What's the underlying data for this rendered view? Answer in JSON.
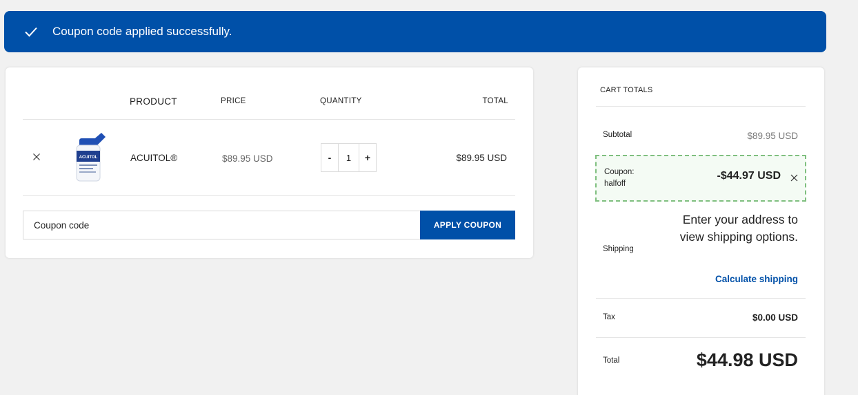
{
  "notice": {
    "icon": "checkmark-icon",
    "message": "Coupon code applied successfully.",
    "color": "#0050a8"
  },
  "cart": {
    "headers": {
      "product": "PRODUCT",
      "price": "PRICE",
      "quantity": "QUANTITY",
      "total": "TOTAL"
    },
    "items": [
      {
        "name": "ACUITOL®",
        "price": "$89.95 USD",
        "quantity": "1",
        "total": "$89.95 USD",
        "thumb_icon": "product-bottle-icon",
        "thumb_label": "ACUITOL"
      }
    ],
    "qty_minus": "-",
    "qty_plus": "+",
    "coupon_placeholder": "Coupon code",
    "apply_label": "APPLY COUPON"
  },
  "totals": {
    "title": "CART TOTALS",
    "subtotal_label": "Subtotal",
    "subtotal_value": "$89.95 USD",
    "coupon_label_line1": "Coupon:",
    "coupon_label_line2": "halfoff",
    "coupon_value": "-$44.97 USD",
    "shipping_label": "Shipping",
    "shipping_text": "Enter your address to view shipping options.",
    "calc_link": "Calculate shipping",
    "tax_label": "Tax",
    "tax_value": "$0.00 USD",
    "total_label": "Total",
    "total_value": "$44.98 USD"
  },
  "colors": {
    "accent": "#0050a8",
    "coupon_border": "#7fbf7f"
  }
}
